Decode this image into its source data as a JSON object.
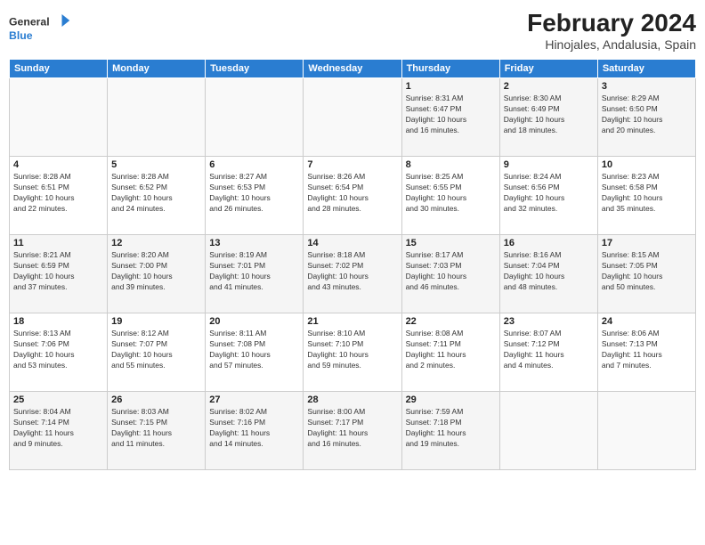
{
  "logo": {
    "line1": "General",
    "line2": "Blue"
  },
  "title": "February 2024",
  "subtitle": "Hinojales, Andalusia, Spain",
  "days_of_week": [
    "Sunday",
    "Monday",
    "Tuesday",
    "Wednesday",
    "Thursday",
    "Friday",
    "Saturday"
  ],
  "weeks": [
    [
      {
        "day": "",
        "info": ""
      },
      {
        "day": "",
        "info": ""
      },
      {
        "day": "",
        "info": ""
      },
      {
        "day": "",
        "info": ""
      },
      {
        "day": "1",
        "info": "Sunrise: 8:31 AM\nSunset: 6:47 PM\nDaylight: 10 hours\nand 16 minutes."
      },
      {
        "day": "2",
        "info": "Sunrise: 8:30 AM\nSunset: 6:49 PM\nDaylight: 10 hours\nand 18 minutes."
      },
      {
        "day": "3",
        "info": "Sunrise: 8:29 AM\nSunset: 6:50 PM\nDaylight: 10 hours\nand 20 minutes."
      }
    ],
    [
      {
        "day": "4",
        "info": "Sunrise: 8:28 AM\nSunset: 6:51 PM\nDaylight: 10 hours\nand 22 minutes."
      },
      {
        "day": "5",
        "info": "Sunrise: 8:28 AM\nSunset: 6:52 PM\nDaylight: 10 hours\nand 24 minutes."
      },
      {
        "day": "6",
        "info": "Sunrise: 8:27 AM\nSunset: 6:53 PM\nDaylight: 10 hours\nand 26 minutes."
      },
      {
        "day": "7",
        "info": "Sunrise: 8:26 AM\nSunset: 6:54 PM\nDaylight: 10 hours\nand 28 minutes."
      },
      {
        "day": "8",
        "info": "Sunrise: 8:25 AM\nSunset: 6:55 PM\nDaylight: 10 hours\nand 30 minutes."
      },
      {
        "day": "9",
        "info": "Sunrise: 8:24 AM\nSunset: 6:56 PM\nDaylight: 10 hours\nand 32 minutes."
      },
      {
        "day": "10",
        "info": "Sunrise: 8:23 AM\nSunset: 6:58 PM\nDaylight: 10 hours\nand 35 minutes."
      }
    ],
    [
      {
        "day": "11",
        "info": "Sunrise: 8:21 AM\nSunset: 6:59 PM\nDaylight: 10 hours\nand 37 minutes."
      },
      {
        "day": "12",
        "info": "Sunrise: 8:20 AM\nSunset: 7:00 PM\nDaylight: 10 hours\nand 39 minutes."
      },
      {
        "day": "13",
        "info": "Sunrise: 8:19 AM\nSunset: 7:01 PM\nDaylight: 10 hours\nand 41 minutes."
      },
      {
        "day": "14",
        "info": "Sunrise: 8:18 AM\nSunset: 7:02 PM\nDaylight: 10 hours\nand 43 minutes."
      },
      {
        "day": "15",
        "info": "Sunrise: 8:17 AM\nSunset: 7:03 PM\nDaylight: 10 hours\nand 46 minutes."
      },
      {
        "day": "16",
        "info": "Sunrise: 8:16 AM\nSunset: 7:04 PM\nDaylight: 10 hours\nand 48 minutes."
      },
      {
        "day": "17",
        "info": "Sunrise: 8:15 AM\nSunset: 7:05 PM\nDaylight: 10 hours\nand 50 minutes."
      }
    ],
    [
      {
        "day": "18",
        "info": "Sunrise: 8:13 AM\nSunset: 7:06 PM\nDaylight: 10 hours\nand 53 minutes."
      },
      {
        "day": "19",
        "info": "Sunrise: 8:12 AM\nSunset: 7:07 PM\nDaylight: 10 hours\nand 55 minutes."
      },
      {
        "day": "20",
        "info": "Sunrise: 8:11 AM\nSunset: 7:08 PM\nDaylight: 10 hours\nand 57 minutes."
      },
      {
        "day": "21",
        "info": "Sunrise: 8:10 AM\nSunset: 7:10 PM\nDaylight: 10 hours\nand 59 minutes."
      },
      {
        "day": "22",
        "info": "Sunrise: 8:08 AM\nSunset: 7:11 PM\nDaylight: 11 hours\nand 2 minutes."
      },
      {
        "day": "23",
        "info": "Sunrise: 8:07 AM\nSunset: 7:12 PM\nDaylight: 11 hours\nand 4 minutes."
      },
      {
        "day": "24",
        "info": "Sunrise: 8:06 AM\nSunset: 7:13 PM\nDaylight: 11 hours\nand 7 minutes."
      }
    ],
    [
      {
        "day": "25",
        "info": "Sunrise: 8:04 AM\nSunset: 7:14 PM\nDaylight: 11 hours\nand 9 minutes."
      },
      {
        "day": "26",
        "info": "Sunrise: 8:03 AM\nSunset: 7:15 PM\nDaylight: 11 hours\nand 11 minutes."
      },
      {
        "day": "27",
        "info": "Sunrise: 8:02 AM\nSunset: 7:16 PM\nDaylight: 11 hours\nand 14 minutes."
      },
      {
        "day": "28",
        "info": "Sunrise: 8:00 AM\nSunset: 7:17 PM\nDaylight: 11 hours\nand 16 minutes."
      },
      {
        "day": "29",
        "info": "Sunrise: 7:59 AM\nSunset: 7:18 PM\nDaylight: 11 hours\nand 19 minutes."
      },
      {
        "day": "",
        "info": ""
      },
      {
        "day": "",
        "info": ""
      }
    ]
  ]
}
